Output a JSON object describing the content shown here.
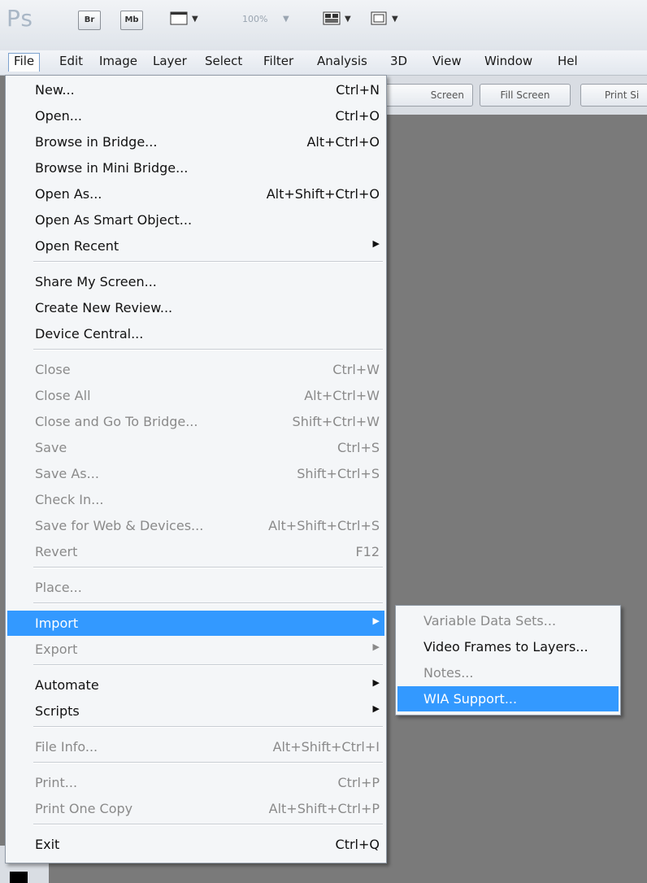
{
  "app": {
    "logo": "Ps",
    "zoom": "100%"
  },
  "toolbar": {
    "bridge_label": "Br",
    "minibridge_label": "Mb",
    "icons": [
      "filmstrip-icon",
      "arrange-icon",
      "screen-mode-icon"
    ]
  },
  "menubar": [
    "File",
    "Edit",
    "Image",
    "Layer",
    "Select",
    "Filter",
    "Analysis",
    "3D",
    "View",
    "Window",
    "Hel"
  ],
  "options_bar": [
    "Screen",
    "Fill Screen",
    "Print Si"
  ],
  "file_menu": {
    "items": [
      {
        "label": "New...",
        "shortcut": "Ctrl+N",
        "state": "enabled"
      },
      {
        "label": "Open...",
        "shortcut": "Ctrl+O",
        "state": "enabled"
      },
      {
        "label": "Browse in Bridge...",
        "shortcut": "Alt+Ctrl+O",
        "state": "enabled"
      },
      {
        "label": "Browse in Mini Bridge...",
        "shortcut": "",
        "state": "enabled"
      },
      {
        "label": "Open As...",
        "shortcut": "Alt+Shift+Ctrl+O",
        "state": "enabled"
      },
      {
        "label": "Open As Smart Object...",
        "shortcut": "",
        "state": "enabled"
      },
      {
        "label": "Open Recent",
        "shortcut": "",
        "state": "enabled",
        "submenu": true
      },
      {
        "label": "Share My Screen...",
        "shortcut": "",
        "state": "enabled"
      },
      {
        "label": "Create New Review...",
        "shortcut": "",
        "state": "enabled"
      },
      {
        "label": "Device Central...",
        "shortcut": "",
        "state": "enabled"
      },
      {
        "label": "Close",
        "shortcut": "Ctrl+W",
        "state": "disabled"
      },
      {
        "label": "Close All",
        "shortcut": "Alt+Ctrl+W",
        "state": "disabled"
      },
      {
        "label": "Close and Go To Bridge...",
        "shortcut": "Shift+Ctrl+W",
        "state": "disabled"
      },
      {
        "label": "Save",
        "shortcut": "Ctrl+S",
        "state": "disabled"
      },
      {
        "label": "Save As...",
        "shortcut": "Shift+Ctrl+S",
        "state": "disabled"
      },
      {
        "label": "Check In...",
        "shortcut": "",
        "state": "disabled"
      },
      {
        "label": "Save for Web & Devices...",
        "shortcut": "Alt+Shift+Ctrl+S",
        "state": "disabled"
      },
      {
        "label": "Revert",
        "shortcut": "F12",
        "state": "disabled"
      },
      {
        "label": "Place...",
        "shortcut": "",
        "state": "disabled"
      },
      {
        "label": "Import",
        "shortcut": "",
        "state": "highlighted",
        "submenu": true
      },
      {
        "label": "Export",
        "shortcut": "",
        "state": "disabled",
        "submenu": true
      },
      {
        "label": "Automate",
        "shortcut": "",
        "state": "enabled",
        "submenu": true
      },
      {
        "label": "Scripts",
        "shortcut": "",
        "state": "enabled",
        "submenu": true
      },
      {
        "label": "File Info...",
        "shortcut": "Alt+Shift+Ctrl+I",
        "state": "disabled"
      },
      {
        "label": "Print...",
        "shortcut": "Ctrl+P",
        "state": "disabled"
      },
      {
        "label": "Print One Copy",
        "shortcut": "Alt+Shift+Ctrl+P",
        "state": "disabled"
      },
      {
        "label": "Exit",
        "shortcut": "Ctrl+Q",
        "state": "enabled"
      }
    ]
  },
  "import_submenu": {
    "items": [
      {
        "label": "Variable Data Sets...",
        "state": "disabled"
      },
      {
        "label": "Video Frames to Layers...",
        "state": "enabled"
      },
      {
        "label": "Notes...",
        "state": "disabled"
      },
      {
        "label": "WIA Support...",
        "state": "highlighted"
      }
    ]
  },
  "colors": {
    "highlight": "#3399ff",
    "disabled_text": "#8a8a8a",
    "canvas_bg": "#7a7a7a"
  }
}
